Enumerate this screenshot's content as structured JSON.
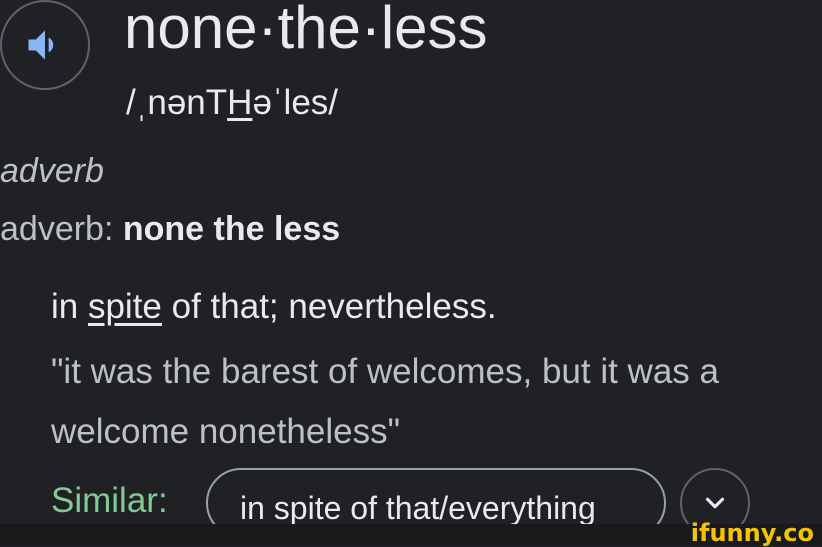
{
  "entry": {
    "speaker_icon": "speaker-icon",
    "headword": "none·the·less",
    "phonetic_pre": "/ˌnənT",
    "phonetic_underlined": "H",
    "phonetic_post": "əˈles/"
  },
  "part_of_speech": {
    "italic_label": "adverb",
    "label_prefix": "adverb:",
    "variant": "none the less"
  },
  "definition": {
    "pre": "in ",
    "link": "spite",
    "post": " of that; nevertheless.",
    "example_line1": "\"it was the barest of welcomes, but it was a",
    "example_line2": "welcome nonetheless\""
  },
  "similar": {
    "label": "Similar:",
    "chip": "in spite of that/everything",
    "expand_icon": "chevron-down-icon"
  },
  "watermark": {
    "text": "ifunny.co"
  },
  "colors": {
    "background": "#202124",
    "speaker_accent": "#8ab4f8",
    "similar_label": "#81c995",
    "watermark": "#f4c400"
  }
}
